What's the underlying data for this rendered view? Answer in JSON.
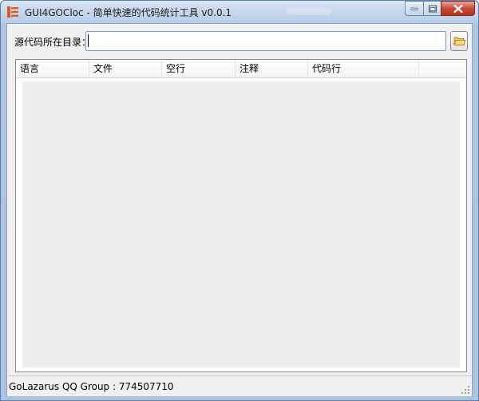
{
  "window": {
    "title": "GUI4GOCloc - 简单快速的代码统计工具 v0.0.1",
    "app_icon": "app-logo-icon"
  },
  "form": {
    "dir_label": "源代码所在目录：",
    "dir_value": "",
    "browse_icon": "folder-open-icon"
  },
  "table": {
    "columns": [
      "语言",
      "文件",
      "空行",
      "注释",
      "代码行"
    ],
    "rows": []
  },
  "statusbar": {
    "text": "GoLazarus QQ Group : 774507710"
  },
  "colors": {
    "title_bar": "#c6d8ee",
    "close_button": "#c74b38",
    "client_bg": "#f0f0f0"
  }
}
